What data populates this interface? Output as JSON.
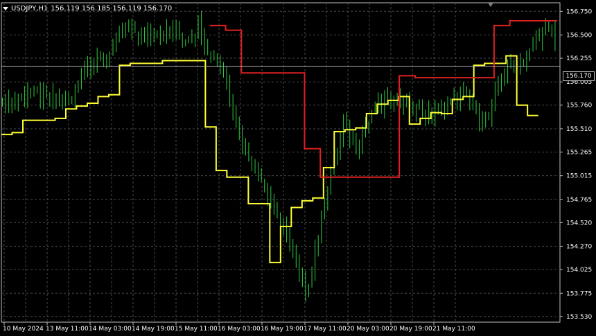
{
  "header": {
    "symbol": "USDJPY,H1",
    "ohlc": "156.119 156.185 156.119 156.170"
  },
  "current_price_label": "156.170",
  "colors": {
    "background": "#000000",
    "grid": "#4a4a4a",
    "candles": "#2ecc40",
    "trail_up": "#ffff33",
    "trail_down": "#e02020",
    "axis_text": "#ffffff",
    "bid_line": "#b0b0b0"
  },
  "chart_data": {
    "type": "line",
    "title": "",
    "xlabel": "",
    "ylabel": "",
    "ylim": [
      153.47,
      156.84
    ],
    "y_ticks": [
      "156.750",
      "156.500",
      "156.255",
      "156.005",
      "155.760",
      "155.510",
      "155.265",
      "155.015",
      "154.765",
      "154.520",
      "154.270",
      "154.025",
      "153.775",
      "153.530"
    ],
    "x_ticks": [
      "10 May 2024",
      "13 May 11:00",
      "14 May 03:00",
      "14 May 19:00",
      "15 May 11:00",
      "16 May 03:00",
      "16 May 19:00",
      "17 May 11:00",
      "20 May 03:00",
      "20 May 19:00",
      "21 May 11:00"
    ],
    "x_range": [
      0,
      176
    ],
    "current_price": 156.17,
    "series": [
      {
        "values": [
          155.45,
          155.47,
          155.6,
          155.6,
          155.6,
          155.62,
          155.72,
          155.75,
          155.78,
          155.85,
          155.87,
          156.18,
          156.2,
          156.2,
          156.2,
          156.23,
          156.23,
          156.23,
          156.23,
          155.53,
          155.07,
          155.0,
          155.0,
          154.72,
          154.72,
          154.1,
          154.48,
          154.68,
          154.75,
          154.78,
          155.1,
          155.48,
          155.5,
          155.52,
          155.67,
          155.77,
          155.81,
          155.85,
          155.56,
          155.62,
          155.68,
          155.67,
          155.82,
          155.85,
          156.18,
          156.2,
          156.2,
          156.28,
          155.76,
          155.65
        ]
      },
      {
        "values": [
          156.6,
          156.55,
          156.1,
          156.1,
          156.1,
          156.1,
          155.3,
          155.0,
          155.0,
          155.0,
          155.0,
          155.0,
          156.07,
          156.05,
          156.05,
          156.05,
          156.05,
          156.05,
          156.6,
          156.65,
          156.65,
          156.65
        ]
      }
    ]
  }
}
